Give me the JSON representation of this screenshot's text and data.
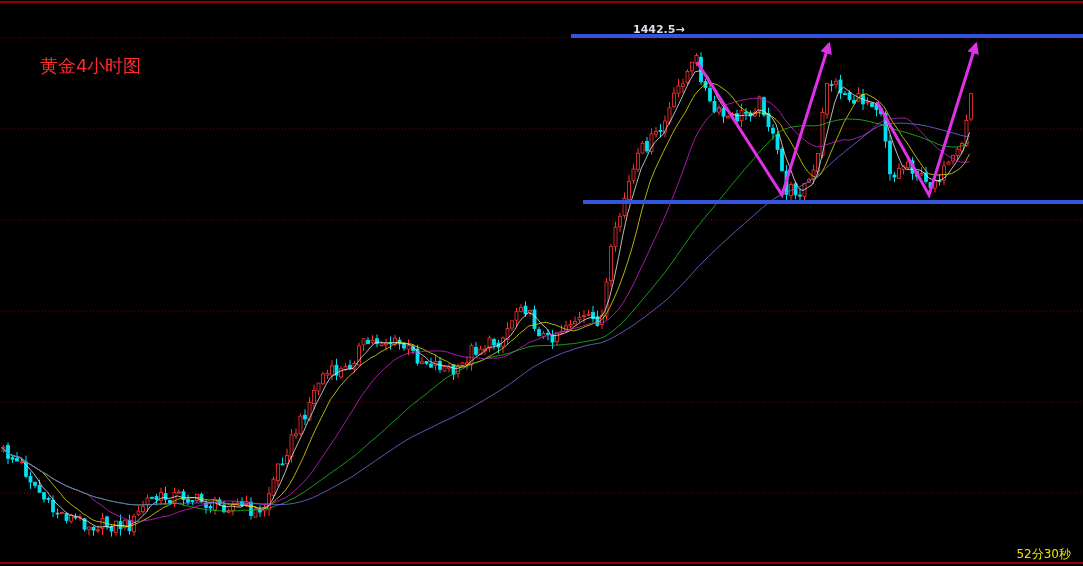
{
  "title": "黄金4小时图",
  "price_label": "1442.5→",
  "countdown": "52分30秒"
}
